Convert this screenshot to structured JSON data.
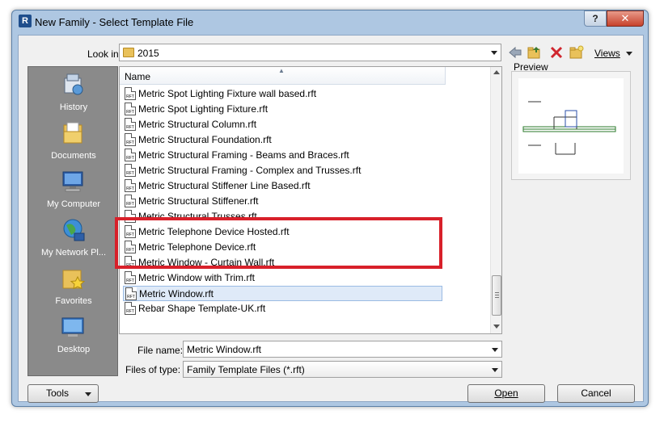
{
  "window": {
    "title": "New Family - Select Template File",
    "help_label": "?",
    "close_label": "✕"
  },
  "lookin": {
    "label": "Look in:",
    "value": "2015"
  },
  "toolbar": {
    "views_label": "Views"
  },
  "places": [
    {
      "label": "History",
      "icon": "history-icon"
    },
    {
      "label": "Documents",
      "icon": "documents-icon"
    },
    {
      "label": "My Computer",
      "icon": "computer-icon"
    },
    {
      "label": "My Network Pl...",
      "icon": "network-icon"
    },
    {
      "label": "Favorites",
      "icon": "favorites-icon"
    },
    {
      "label": "Desktop",
      "icon": "desktop-icon"
    }
  ],
  "filelist": {
    "column_name": "Name",
    "icon_text": "RFT",
    "files": [
      "Metric Spot Lighting Fixture wall based.rft",
      "Metric Spot Lighting Fixture.rft",
      "Metric Structural Column.rft",
      "Metric Structural Foundation.rft",
      "Metric Structural Framing - Beams and Braces.rft",
      "Metric Structural Framing - Complex and Trusses.rft",
      "Metric Structural Stiffener Line Based.rft",
      "Metric Structural Stiffener.rft",
      "Metric Structural Trusses.rft",
      "Metric Telephone Device Hosted.rft",
      "Metric Telephone Device.rft",
      "Metric Window - Curtain Wall.rft",
      "Metric Window with Trim.rft",
      "Metric Window.rft",
      "Rebar Shape Template-UK.rft"
    ],
    "selected": "Metric Window.rft"
  },
  "preview": {
    "label": "Preview"
  },
  "filename": {
    "label": "File name:",
    "value": "Metric Window.rft"
  },
  "filetype": {
    "label": "Files of type:",
    "value": "Family Template Files  (*.rft)"
  },
  "buttons": {
    "tools": "Tools",
    "open": "Open",
    "cancel": "Cancel"
  },
  "colors": {
    "highlight": "#d8202a",
    "frame": "#aec7e2",
    "places_bg": "#8a8a8a"
  }
}
